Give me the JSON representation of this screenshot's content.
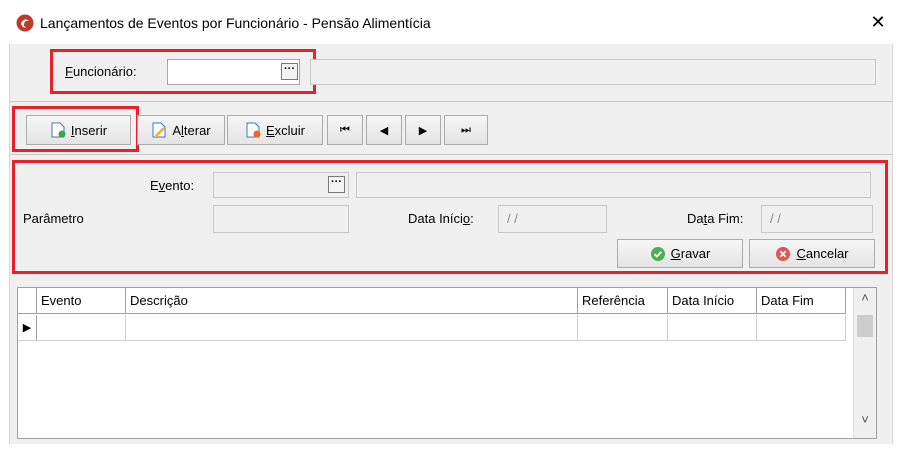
{
  "window": {
    "title": "Lançamentos de Eventos por Funcionário - Pensão Alimentícia",
    "close_glyph": "✕"
  },
  "funcionario": {
    "label_underline": "F",
    "label_rest": "uncionário:",
    "value": "",
    "dots": "···",
    "name_value": ""
  },
  "toolbar": {
    "inserir": {
      "u": "I",
      "rest": "nserir"
    },
    "alterar": {
      "pre": "A",
      "u": "l",
      "rest": "terar"
    },
    "excluir": {
      "u": "E",
      "rest": "xcluir"
    },
    "first": "⏮",
    "prev": "◀",
    "next": "▶",
    "last": "⏭"
  },
  "form": {
    "evento_pre": "E",
    "evento_u": "v",
    "evento_rest": "ento:",
    "evento_dots": "···",
    "parametro": "Parâmetro",
    "data_inicio_pre": "Data Iníci",
    "data_inicio_u": "o",
    "data_inicio_rest": ":",
    "data_inicio_value": " / /",
    "data_fim_pre": "Da",
    "data_fim_u": "t",
    "data_fim_rest": "a Fim:",
    "data_fim_value": " / /",
    "gravar_u": "G",
    "gravar_rest": "ravar",
    "cancelar_u": "C",
    "cancelar_rest": "ancelar"
  },
  "grid": {
    "columns": [
      "Evento",
      "Descrição",
      "Referência",
      "Data Início",
      "Data Fim"
    ],
    "row_indicator": "▶",
    "scroll_up": "˄",
    "scroll_down": "˅"
  },
  "colors": {
    "highlight": "#e8202a",
    "accent_icon": "#c0392b"
  }
}
